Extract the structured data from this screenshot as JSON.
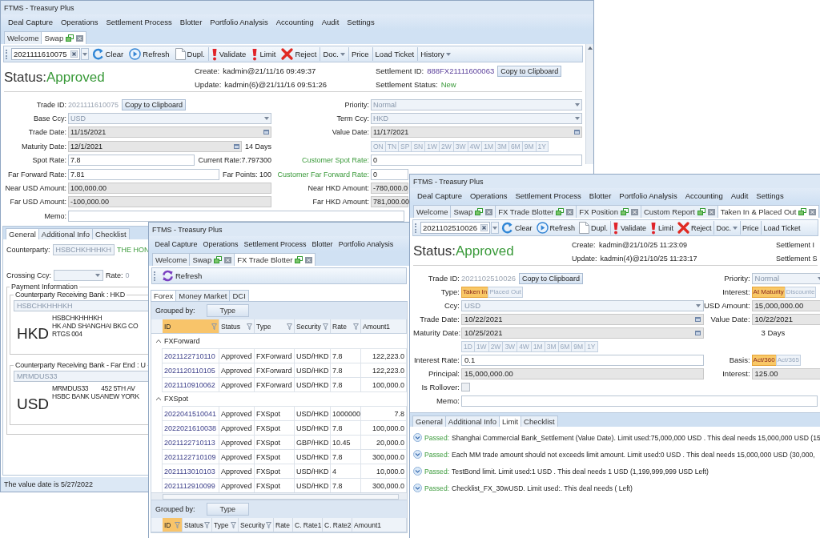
{
  "swap_window": {
    "title": "FTMS - Treasury Plus",
    "menu": [
      "Deal Capture",
      "Operations",
      "Settlement Process",
      "Blotter",
      "Portfolio Analysis",
      "Accounting",
      "Audit",
      "Settings"
    ],
    "tabs": [
      {
        "label": "Welcome",
        "selected": false,
        "closable": false
      },
      {
        "label": "Swap",
        "selected": true,
        "closable": true
      }
    ],
    "toolbar": [
      {
        "kind": "id",
        "value": "2021111610075"
      },
      {
        "kind": "clear",
        "label": "Clear"
      },
      {
        "kind": "refresh",
        "label": "Refresh"
      },
      {
        "kind": "copy",
        "label": "Dupl."
      },
      {
        "kind": "alert",
        "label": "Validate"
      },
      {
        "kind": "alert",
        "label": "Limit"
      },
      {
        "kind": "reject",
        "label": "Reject"
      },
      {
        "kind": "dropdown",
        "label": "Doc."
      },
      {
        "kind": "text",
        "label": "Price"
      },
      {
        "kind": "text",
        "label": "Load Ticket"
      },
      {
        "kind": "dropdown",
        "label": "History"
      }
    ],
    "header": {
      "status_label": "Status:",
      "status": "Approved",
      "create_label": "Create:",
      "create": "kadmin@21/11/16 09:49:37",
      "update_label": "Update:",
      "update": "kadmin(6)@21/11/16 09:51:26",
      "settlement_id_label": "Settlement ID:",
      "settlement_id": "888FX21111600063",
      "copy": "Copy to Clipboard",
      "settlement_status_label": "Settlement Status:",
      "settlement_status": "New"
    },
    "rows": [
      {
        "left": {
          "label": "Trade ID:",
          "kind": "id",
          "value": "2021111610075",
          "button": "Copy to Clipboard"
        },
        "right": {
          "label": "Priority:",
          "kind": "combo",
          "value": "Normal"
        }
      },
      {
        "left": {
          "label": "Base Ccy:",
          "kind": "combo",
          "value": "USD"
        },
        "right": {
          "label": "Term Ccy:",
          "kind": "combo",
          "value": "HKD"
        }
      },
      {
        "left": {
          "label": "Trade Date:",
          "kind": "date",
          "value": "11/15/2021"
        },
        "right": {
          "label": "Value Date:",
          "kind": "date",
          "value": "11/17/2021"
        }
      },
      {
        "left": {
          "label": "Maturity Date:",
          "kind": "date",
          "value": "12/1/2021",
          "note": "14 Days"
        },
        "right": {
          "kind": "tenor",
          "options": [
            "ON",
            "TN",
            "SP",
            "SN",
            "1W",
            "2W",
            "3W",
            "4W",
            "1M",
            "3M",
            "6M",
            "9M",
            "1Y"
          ]
        }
      },
      {
        "left": {
          "label": "Spot Rate:",
          "kind": "text",
          "value": "7.8",
          "note": "Current Rate:7.797300"
        },
        "right": {
          "label": "Customer Spot Rate:",
          "kind": "text",
          "value": "0",
          "highlight": true
        }
      },
      {
        "left": {
          "label": "Far Forward Rate:",
          "kind": "text",
          "value": "7.81",
          "note": "Far Points: 100"
        },
        "right": {
          "label": "Customer Far Forward Rate:",
          "kind": "text",
          "value": "0",
          "highlight": true
        }
      },
      {
        "left": {
          "label": "Near USD Amount:",
          "kind": "readonly",
          "value": "100,000.00"
        },
        "right": {
          "label": "Near HKD Amount:",
          "kind": "readonly",
          "value": "-780,000.0"
        }
      },
      {
        "left": {
          "label": "Far USD Amount:",
          "kind": "readonly",
          "value": "-100,000.00"
        },
        "right": {
          "label": "Far HKD Amount:",
          "kind": "readonly",
          "value": "781,000.00"
        }
      }
    ],
    "memo": {
      "label": "Memo:"
    },
    "detail_tabs": [
      {
        "label": "General",
        "selected": true
      },
      {
        "label": "Additional Info",
        "selected": false
      },
      {
        "label": "Checklist",
        "selected": false
      }
    ],
    "counterparty": {
      "label": "Counterparty:",
      "value": "HSBCHKHHHKH",
      "name": "THE HON"
    },
    "crossing": {
      "label": "Crossing Ccy:",
      "rate_label": "Rate:",
      "rate": "0"
    },
    "payment": {
      "title": "Payment Information",
      "banks": [
        {
          "title": "Counterparty Receiving Bank : HKD",
          "code": "HSBCHKHHHKH",
          "currency": "HKD",
          "lines": [
            [
              "HSBCHKHHHKH"
            ],
            [
              "HK AND SHANGHAI BKG CO"
            ],
            [
              "RTGS 004"
            ]
          ]
        },
        {
          "title": "Counterparty Receiving Bank - Far End : U",
          "code": "MRMDUS33",
          "currency": "USD",
          "lines": [
            [
              "MRMDUS33",
              "452 5TH AV"
            ],
            [
              "HSBC BANK USANEW YORK"
            ]
          ]
        }
      ]
    },
    "status_bar": "The value date is 5/27/2022"
  },
  "blotter_window": {
    "title": "FTMS - Treasury Plus",
    "menu": [
      "Deal Capture",
      "Operations",
      "Settlement Process",
      "Blotter",
      "Portfolio Analysis"
    ],
    "tabs": [
      {
        "label": "Welcome",
        "selected": false,
        "closable": false
      },
      {
        "label": "Swap",
        "selected": false,
        "closable": true
      },
      {
        "label": "FX Trade Blotter",
        "selected": true,
        "closable": true
      }
    ],
    "refresh": "Refresh",
    "subtabs": [
      {
        "label": "Forex",
        "selected": true
      },
      {
        "label": "Money Market",
        "selected": false
      },
      {
        "label": "DCI",
        "selected": false
      }
    ],
    "grids": [
      {
        "grouped_by_label": "Grouped by:",
        "grouped_by": "Type",
        "columns": [
          {
            "label": "ID",
            "sorted": true,
            "filter": true
          },
          {
            "label": "Status",
            "sorted": false,
            "filter": true
          },
          {
            "label": "Type",
            "sorted": false,
            "filter": true
          },
          {
            "label": "Security",
            "sorted": false,
            "filter": true
          },
          {
            "label": "Rate",
            "sorted": false,
            "filter": true
          },
          {
            "label": "Amount1",
            "sorted": false,
            "filter": false
          }
        ],
        "groups": [
          {
            "name": "FXForward",
            "expanded": true,
            "rows": [
              [
                "2021122710110",
                "Approved",
                "FXForward",
                "USD/HKD",
                "7.8",
                "122,223.0"
              ],
              [
                "2021120110105",
                "Approved",
                "FXForward",
                "USD/HKD",
                "7.8",
                "122,223.0"
              ],
              [
                "2021110910062",
                "Approved",
                "FXForward",
                "USD/HKD",
                "7.8",
                "100,000.0"
              ]
            ]
          },
          {
            "name": "FXSpot",
            "expanded": true,
            "rows": [
              [
                "2022041510041",
                "Approved",
                "FXSpot",
                "USD/HKD",
                "1000000",
                "7.8"
              ],
              [
                "2022021610038",
                "Approved",
                "FXSpot",
                "USD/HKD",
                "7.8",
                "100,000.0"
              ],
              [
                "2021122710113",
                "Approved",
                "FXSpot",
                "GBP/HKD",
                "10.45",
                "20,000.0"
              ],
              [
                "2021122710109",
                "Approved",
                "FXSpot",
                "USD/HKD",
                "7.8",
                "300,000.0"
              ],
              [
                "2021113010103",
                "Approved",
                "FXSpot",
                "USD/HKD",
                "4",
                "10,000.0"
              ],
              [
                "2021112910099",
                "Approved",
                "FXSpot",
                "USD/HKD",
                "7.8",
                "300,000.0"
              ]
            ]
          }
        ]
      },
      {
        "grouped_by_label": "Grouped by:",
        "grouped_by": "Type",
        "columns": [
          {
            "label": "ID",
            "sorted": true,
            "filter": true
          },
          {
            "label": "Status",
            "sorted": false,
            "filter": true
          },
          {
            "label": "Type",
            "sorted": false,
            "filter": true
          },
          {
            "label": "Security",
            "sorted": false,
            "filter": true
          },
          {
            "label": "Rate",
            "sorted": false,
            "filter": false
          },
          {
            "label": "C. Rate1",
            "sorted": false,
            "filter": false
          },
          {
            "label": "C. Rate2",
            "sorted": false,
            "filter": false
          },
          {
            "label": "Amount1",
            "sorted": false,
            "filter": false
          }
        ]
      }
    ]
  },
  "deposit_window": {
    "title": "FTMS - Treasury Plus",
    "menu": [
      "Deal Capture",
      "Operations",
      "Settlement Process",
      "Blotter",
      "Portfolio Analysis",
      "Accounting",
      "Audit",
      "Settings"
    ],
    "tabs": [
      {
        "label": "Welcome",
        "selected": false,
        "closable": false
      },
      {
        "label": "Swap",
        "selected": false,
        "closable": true
      },
      {
        "label": "FX Trade Blotter",
        "selected": false,
        "closable": true
      },
      {
        "label": "FX Position",
        "selected": false,
        "closable": true
      },
      {
        "label": "Custom Report",
        "selected": false,
        "closable": true
      },
      {
        "label": "Taken In & Placed Out",
        "selected": true,
        "closable": true
      }
    ],
    "toolbar": [
      {
        "kind": "id",
        "value": "2021102510026"
      },
      {
        "kind": "clear",
        "label": "Clear"
      },
      {
        "kind": "refresh",
        "label": "Refresh"
      },
      {
        "kind": "copy",
        "label": "Dupl."
      },
      {
        "kind": "alert",
        "label": "Validate"
      },
      {
        "kind": "alert",
        "label": "Limit"
      },
      {
        "kind": "reject",
        "label": "Reject"
      },
      {
        "kind": "dropdown",
        "label": "Doc."
      },
      {
        "kind": "text",
        "label": "Price"
      },
      {
        "kind": "text",
        "label": "Load Ticket"
      }
    ],
    "header": {
      "status_label": "Status:",
      "status": "Approved",
      "create_label": "Create:",
      "create": "kadmin@21/10/25 11:23:09",
      "update_label": "Update:",
      "update": "kadmin(4)@21/10/25 11:23:17",
      "settlement_id_label": "Settlement I",
      "settlement_status_label": "Settlement S"
    },
    "rows": [
      {
        "left": {
          "label": "Trade ID:",
          "kind": "id",
          "value": "2021102510026",
          "button": "Copy to Clipboard"
        },
        "right": {
          "label": "Priority:",
          "kind": "combo",
          "value": "Normal"
        }
      },
      {
        "left": {
          "label": "Type:",
          "kind": "toggle",
          "options": [
            {
              "label": "Taken In",
              "selected": true
            },
            {
              "label": "Placed Out",
              "selected": false
            }
          ]
        },
        "right": {
          "label": "Interest:",
          "kind": "toggle",
          "options": [
            {
              "label": "At Maturity",
              "selected": true
            },
            {
              "label": "Discounte",
              "selected": false
            }
          ]
        }
      },
      {
        "left": {
          "label": "Ccy:",
          "kind": "combo",
          "value": "USD"
        },
        "right": {
          "label": "USD Amount:",
          "kind": "readonly",
          "value": "15,000,000.00"
        }
      },
      {
        "left": {
          "label": "Trade Date:",
          "kind": "date",
          "value": "10/22/2021"
        },
        "right": {
          "label": "Value Date:",
          "kind": "readonly",
          "value": "10/22/2021"
        }
      },
      {
        "left": {
          "label": "Maturity Date:",
          "kind": "date",
          "value": "10/25/2021"
        },
        "right": {
          "kind": "note",
          "value": "3 Days"
        }
      },
      {
        "left": {
          "kind": "tenor",
          "options": [
            "1D",
            "1W",
            "2W",
            "3W",
            "4W",
            "1M",
            "3M",
            "6M",
            "9M",
            "1Y"
          ]
        }
      },
      {
        "left": {
          "label": "Interest Rate:",
          "kind": "text",
          "value": "0.1"
        },
        "right": {
          "label": "Basis:",
          "kind": "toggle",
          "options": [
            {
              "label": "Act/360",
              "selected": true
            },
            {
              "label": "Act/365",
              "selected": false
            }
          ]
        }
      },
      {
        "left": {
          "label": "Principal:",
          "kind": "readonly",
          "value": "15,000,000.00"
        },
        "right": {
          "label": "Interest:",
          "kind": "readonly",
          "value": "125.00"
        }
      },
      {
        "left": {
          "label": "Is Rollover:",
          "kind": "checkbox",
          "checked": false
        }
      }
    ],
    "memo": {
      "label": "Memo:"
    },
    "detail_tabs": [
      {
        "label": "General",
        "selected": false
      },
      {
        "label": "Additional Info",
        "selected": false
      },
      {
        "label": "Limit",
        "selected": true
      },
      {
        "label": "Checklist",
        "selected": false
      }
    ],
    "limits": [
      {
        "status": "Passed:",
        "text": "Shanghai Commercial Bank_Settlement (Value Date). Limit used:75,000,000 USD . This deal needs 15,000,000 USD (15"
      },
      {
        "status": "Passed:",
        "text": "Each MM trade amount should not exceeds limit amount. Limit used:0 USD . This deal needs 15,000,000 USD (30,000,"
      },
      {
        "status": "Passed:",
        "text": "TestBond limit. Limit used:1 USD . This deal needs 1 USD (1,199,999,999 USD  Left)"
      },
      {
        "status": "Passed:",
        "text": "Checklist_FX_30wUSD. Limit used:. This deal needs ( Left)"
      }
    ]
  }
}
